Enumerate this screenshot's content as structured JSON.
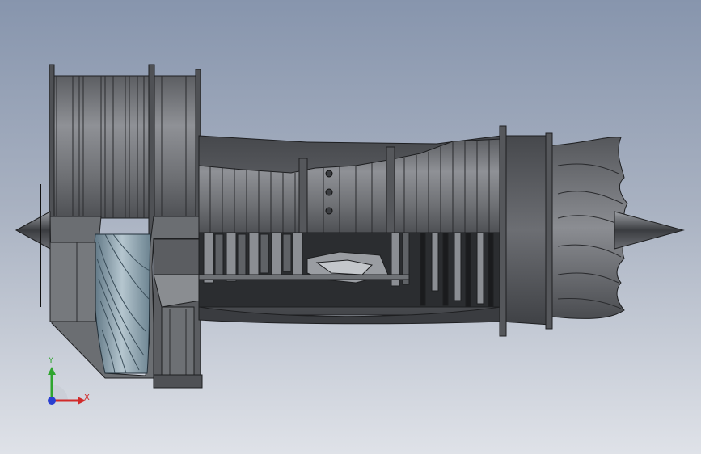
{
  "viewport": {
    "background_top": "#8795ad",
    "background_bottom": "#dfe2e8",
    "model_name": "turbofan-engine-section-view"
  },
  "triad": {
    "y_label": "Y",
    "x_label": "X",
    "y_color": "#2fa52f",
    "x_color": "#d12a2a",
    "z_color": "#2a3fd1"
  }
}
